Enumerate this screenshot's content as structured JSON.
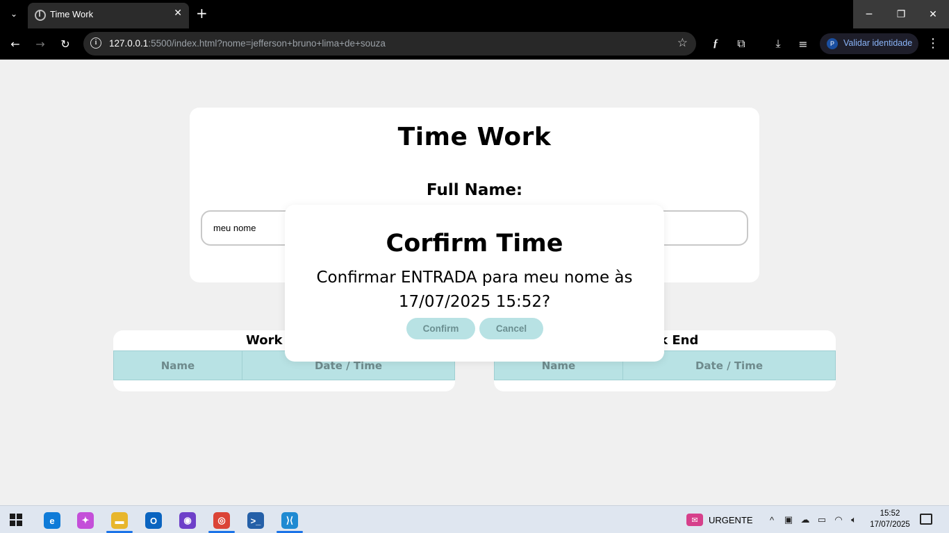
{
  "browser": {
    "tab_title": "Time Work",
    "tab_close": "✕",
    "new_tab": "+",
    "url_host": "127.0.0.1",
    "url_rest": ":5500/index.html?nome=jefferson+bruno+lima+de+souza",
    "profile_initial": "P",
    "profile_label": "Validar identidade"
  },
  "page": {
    "title": "Time Work",
    "name_label": "Full Name:",
    "name_value": "meu nome",
    "tables": [
      {
        "title": "Work Start",
        "col_name": "Name",
        "col_datetime": "Date / Time"
      },
      {
        "title": "Work End",
        "col_name": "Name",
        "col_datetime": "Date / Time"
      }
    ]
  },
  "modal": {
    "title": "Corfirm Time",
    "message": "Confirmar ENTRADA para meu nome às 17/07/2025 15:52?",
    "confirm_label": "Confirm",
    "cancel_label": "Cancel"
  },
  "taskbar": {
    "apps": [
      {
        "name": "edge-icon",
        "color": "#0f7bd8",
        "glyph": "e"
      },
      {
        "name": "copilot-icon",
        "color": "#c44fd9",
        "glyph": "✦"
      },
      {
        "name": "file-explorer-icon",
        "color": "#e8b62c",
        "glyph": "▬"
      },
      {
        "name": "outlook-icon",
        "color": "#0a64c0",
        "glyph": "O"
      },
      {
        "name": "github-desktop-icon",
        "color": "#6e40c9",
        "glyph": "◉"
      },
      {
        "name": "chrome-icon",
        "color": "#db4437",
        "glyph": "◎"
      },
      {
        "name": "powershell-icon",
        "color": "#2560a8",
        "glyph": ">_"
      },
      {
        "name": "vscode-icon",
        "color": "#1f8ad2",
        "glyph": "⟩⟨"
      }
    ],
    "urgent_label": "URGENTE",
    "time": "15:52",
    "date": "17/07/2025"
  }
}
